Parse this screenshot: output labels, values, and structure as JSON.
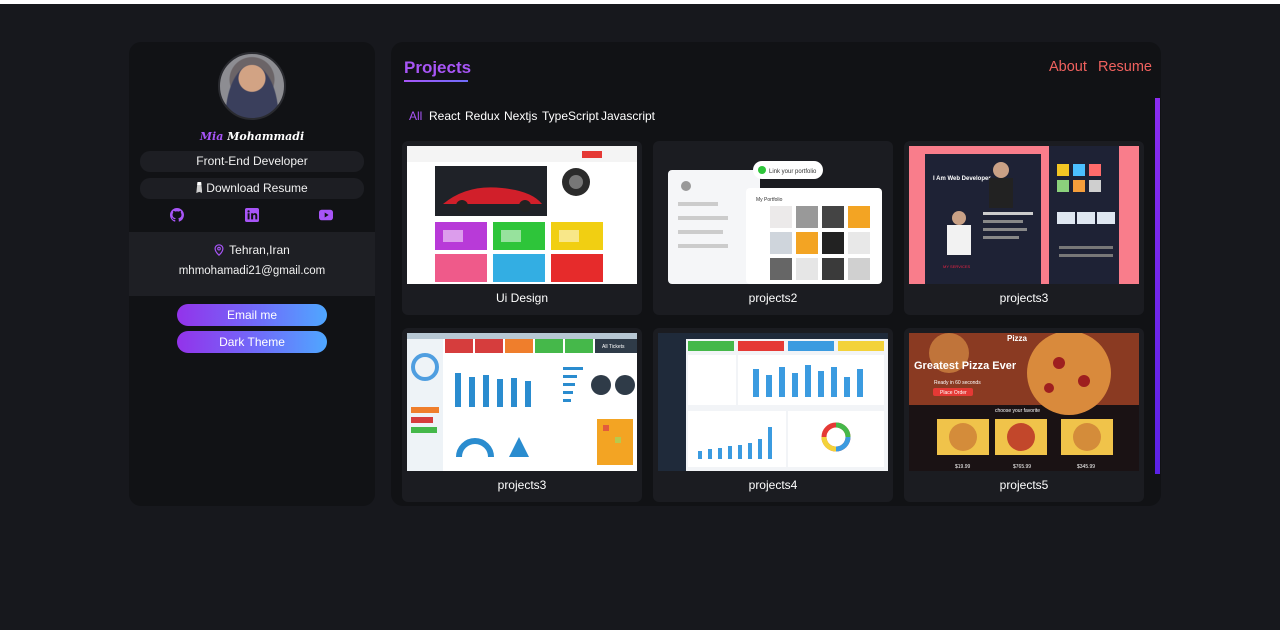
{
  "profile": {
    "first_name": "Mia",
    "last_name": "Mohammadi",
    "role": "Front-End Developer",
    "download_label": "Download Resume",
    "location": "Tehran,Iran",
    "email": "mhmohamadi21@gmail.com",
    "email_button": "Email me",
    "theme_button": "Dark Theme"
  },
  "socials": [
    "github-icon",
    "linkedin-icon",
    "youtube-icon"
  ],
  "header": {
    "title": "Projects",
    "nav": [
      "About",
      "Resume"
    ]
  },
  "filters": [
    "All",
    "React",
    "Redux",
    "Nextjs",
    "TypeScript",
    "Javascript"
  ],
  "active_filter": "All",
  "projects": [
    {
      "title": "Ui Design"
    },
    {
      "title": "projects2"
    },
    {
      "title": "projects3"
    },
    {
      "title": "projects3"
    },
    {
      "title": "projects4"
    },
    {
      "title": "projects5"
    }
  ],
  "thumb_text": {
    "portfolio_tag": "Link your portfolio",
    "portfolio_header": "My Portfolio",
    "dev_heading": "I Am Web Developer",
    "services_label": "MY SERVICES",
    "all_tickets": "All Tickets",
    "pizza_title": "Pizza",
    "pizza_headline": "Greatest Pizza Ever",
    "pizza_sub": "Ready in 60 seconds",
    "pizza_button": "Place Order",
    "pizza_choose": "choose your favorite",
    "pizza_prices": [
      "$19.99",
      "$765.99",
      "$345.99"
    ]
  },
  "colors": {
    "accent": "#a855f7",
    "nav_link": "#f0615e",
    "background": "#17181d",
    "panel": "#111215"
  }
}
